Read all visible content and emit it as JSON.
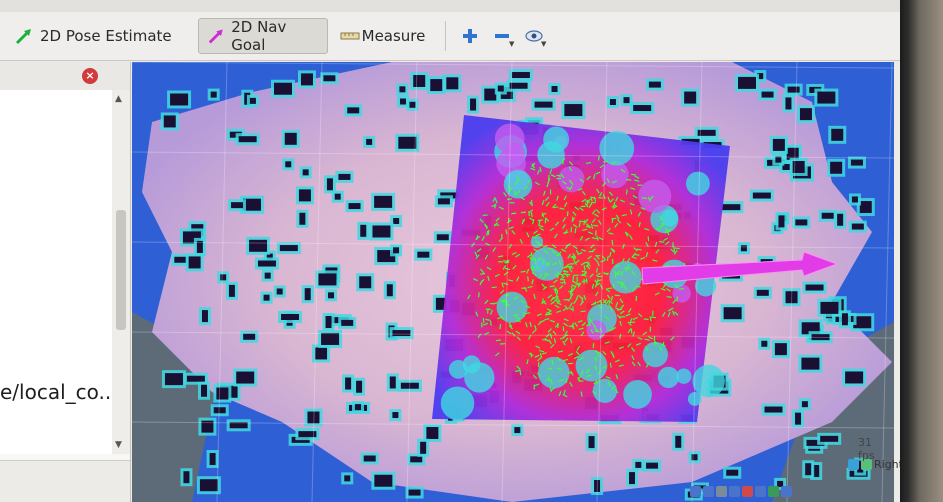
{
  "toolbar": {
    "tools": [
      {
        "label": "2D Pose Estimate",
        "icon": "pose-arrow-icon",
        "color": "#18b33a"
      },
      {
        "label": "2D Nav Goal",
        "icon": "goal-arrow-icon",
        "color": "#d02ad6",
        "active": true
      },
      {
        "label": "Measure",
        "icon": "ruler-icon"
      }
    ],
    "icons": [
      "plus-icon",
      "minus-icon",
      "eye-icon"
    ]
  },
  "left_panel": {
    "visible_text": "e/local_co..."
  },
  "viewport": {
    "fps_text": "31 fps"
  },
  "status": {
    "right_label": "Right"
  },
  "colors": {
    "unknown": "#2f5fd4",
    "free": "#e9c4d8",
    "obstacle": "#1a1033",
    "inflation": "#40d8e0",
    "costmap_high": "#ff2030",
    "costmap_low": "#6a3cf0",
    "particles": "#3bff3b",
    "goal_arrow": "#e23ce8"
  }
}
